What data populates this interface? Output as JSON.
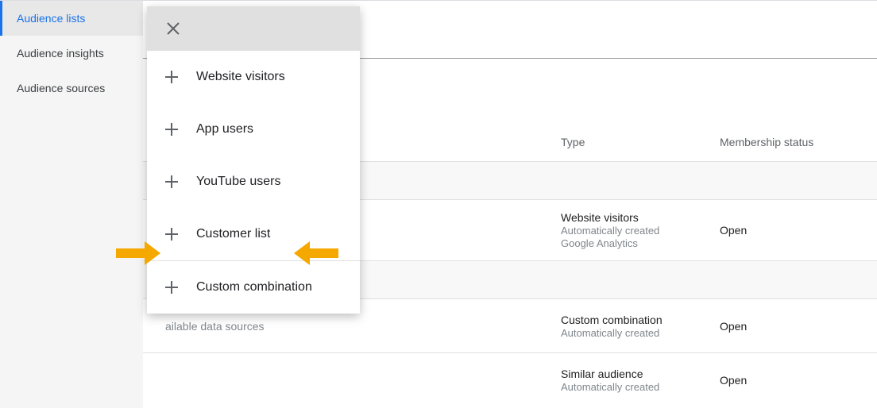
{
  "sidebar": {
    "items": [
      {
        "label": "Audience lists",
        "active": true
      },
      {
        "label": "Audience insights",
        "active": false
      },
      {
        "label": "Audience sources",
        "active": false
      }
    ]
  },
  "page": {
    "title": "Audience lists"
  },
  "table": {
    "headers": {
      "type": "Type",
      "status": "Membership status"
    },
    "rows": [
      {
        "name_fragment": "",
        "type_lines": [
          "Website visitors",
          "Automatically created",
          "Google Analytics"
        ],
        "status": "Open"
      },
      {
        "name_fragment": "ailable data sources",
        "type_lines": [
          "Custom combination",
          "Automatically created"
        ],
        "status": "Open"
      },
      {
        "name_fragment": "",
        "type_lines": [
          "Similar audience",
          "Automatically created"
        ],
        "status": "Open"
      }
    ]
  },
  "popup": {
    "items": [
      {
        "label": "Website visitors"
      },
      {
        "label": "App users"
      },
      {
        "label": "YouTube users"
      },
      {
        "label": "Customer list"
      },
      {
        "label": "Custom combination"
      }
    ]
  }
}
